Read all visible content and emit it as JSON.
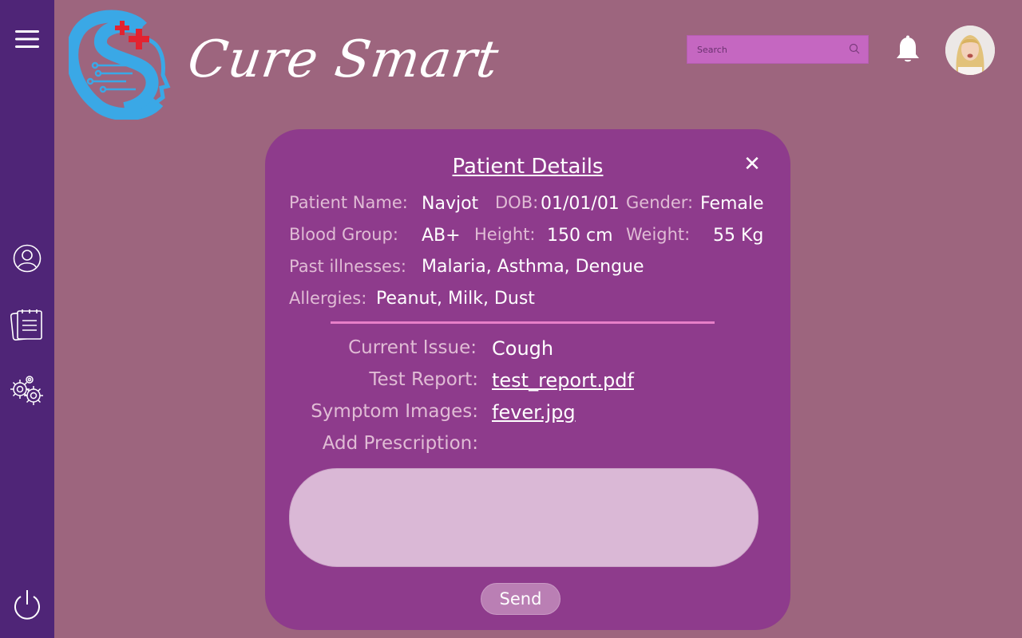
{
  "app": {
    "brand": "Cure Smart"
  },
  "header": {
    "search_placeholder": "Search"
  },
  "sidebar": {
    "items": [
      {
        "icon": "hamburger-menu-icon"
      },
      {
        "icon": "user-profile-icon"
      },
      {
        "icon": "notepad-icon"
      },
      {
        "icon": "settings-gears-icon"
      },
      {
        "icon": "power-icon"
      }
    ]
  },
  "card": {
    "title": "Patient Details",
    "close_label": "✕",
    "patient_name_label": "Patient Name:",
    "patient_name": "Navjot",
    "dob_label": "DOB:",
    "dob": "01/01/01",
    "gender_label": "Gender:",
    "gender": "Female",
    "blood_group_label": "Blood Group:",
    "blood_group": "AB+",
    "height_label": "Height:",
    "height": "150 cm",
    "weight_label": "Weight:",
    "weight": "55 Kg",
    "past_illnesses_label": "Past illnesses:",
    "past_illnesses": "Malaria, Asthma, Dengue",
    "allergies_label": "Allergies:",
    "allergies": "Peanut, Milk, Dust",
    "current_issue_label": "Current Issue:",
    "current_issue": "Cough",
    "test_report_label": "Test Report:",
    "test_report": "test_report.pdf",
    "symptom_images_label": "Symptom Images:",
    "symptom_images": "fever.jpg",
    "add_prescription_label": "Add Prescription:",
    "prescription_value": "",
    "send_label": "Send"
  },
  "colors": {
    "background": "#9d657e",
    "sidebar": "#4f2577",
    "card": "#8e3b8c",
    "accent_line": "#e77fc8",
    "search_bg": "#c567c1"
  }
}
